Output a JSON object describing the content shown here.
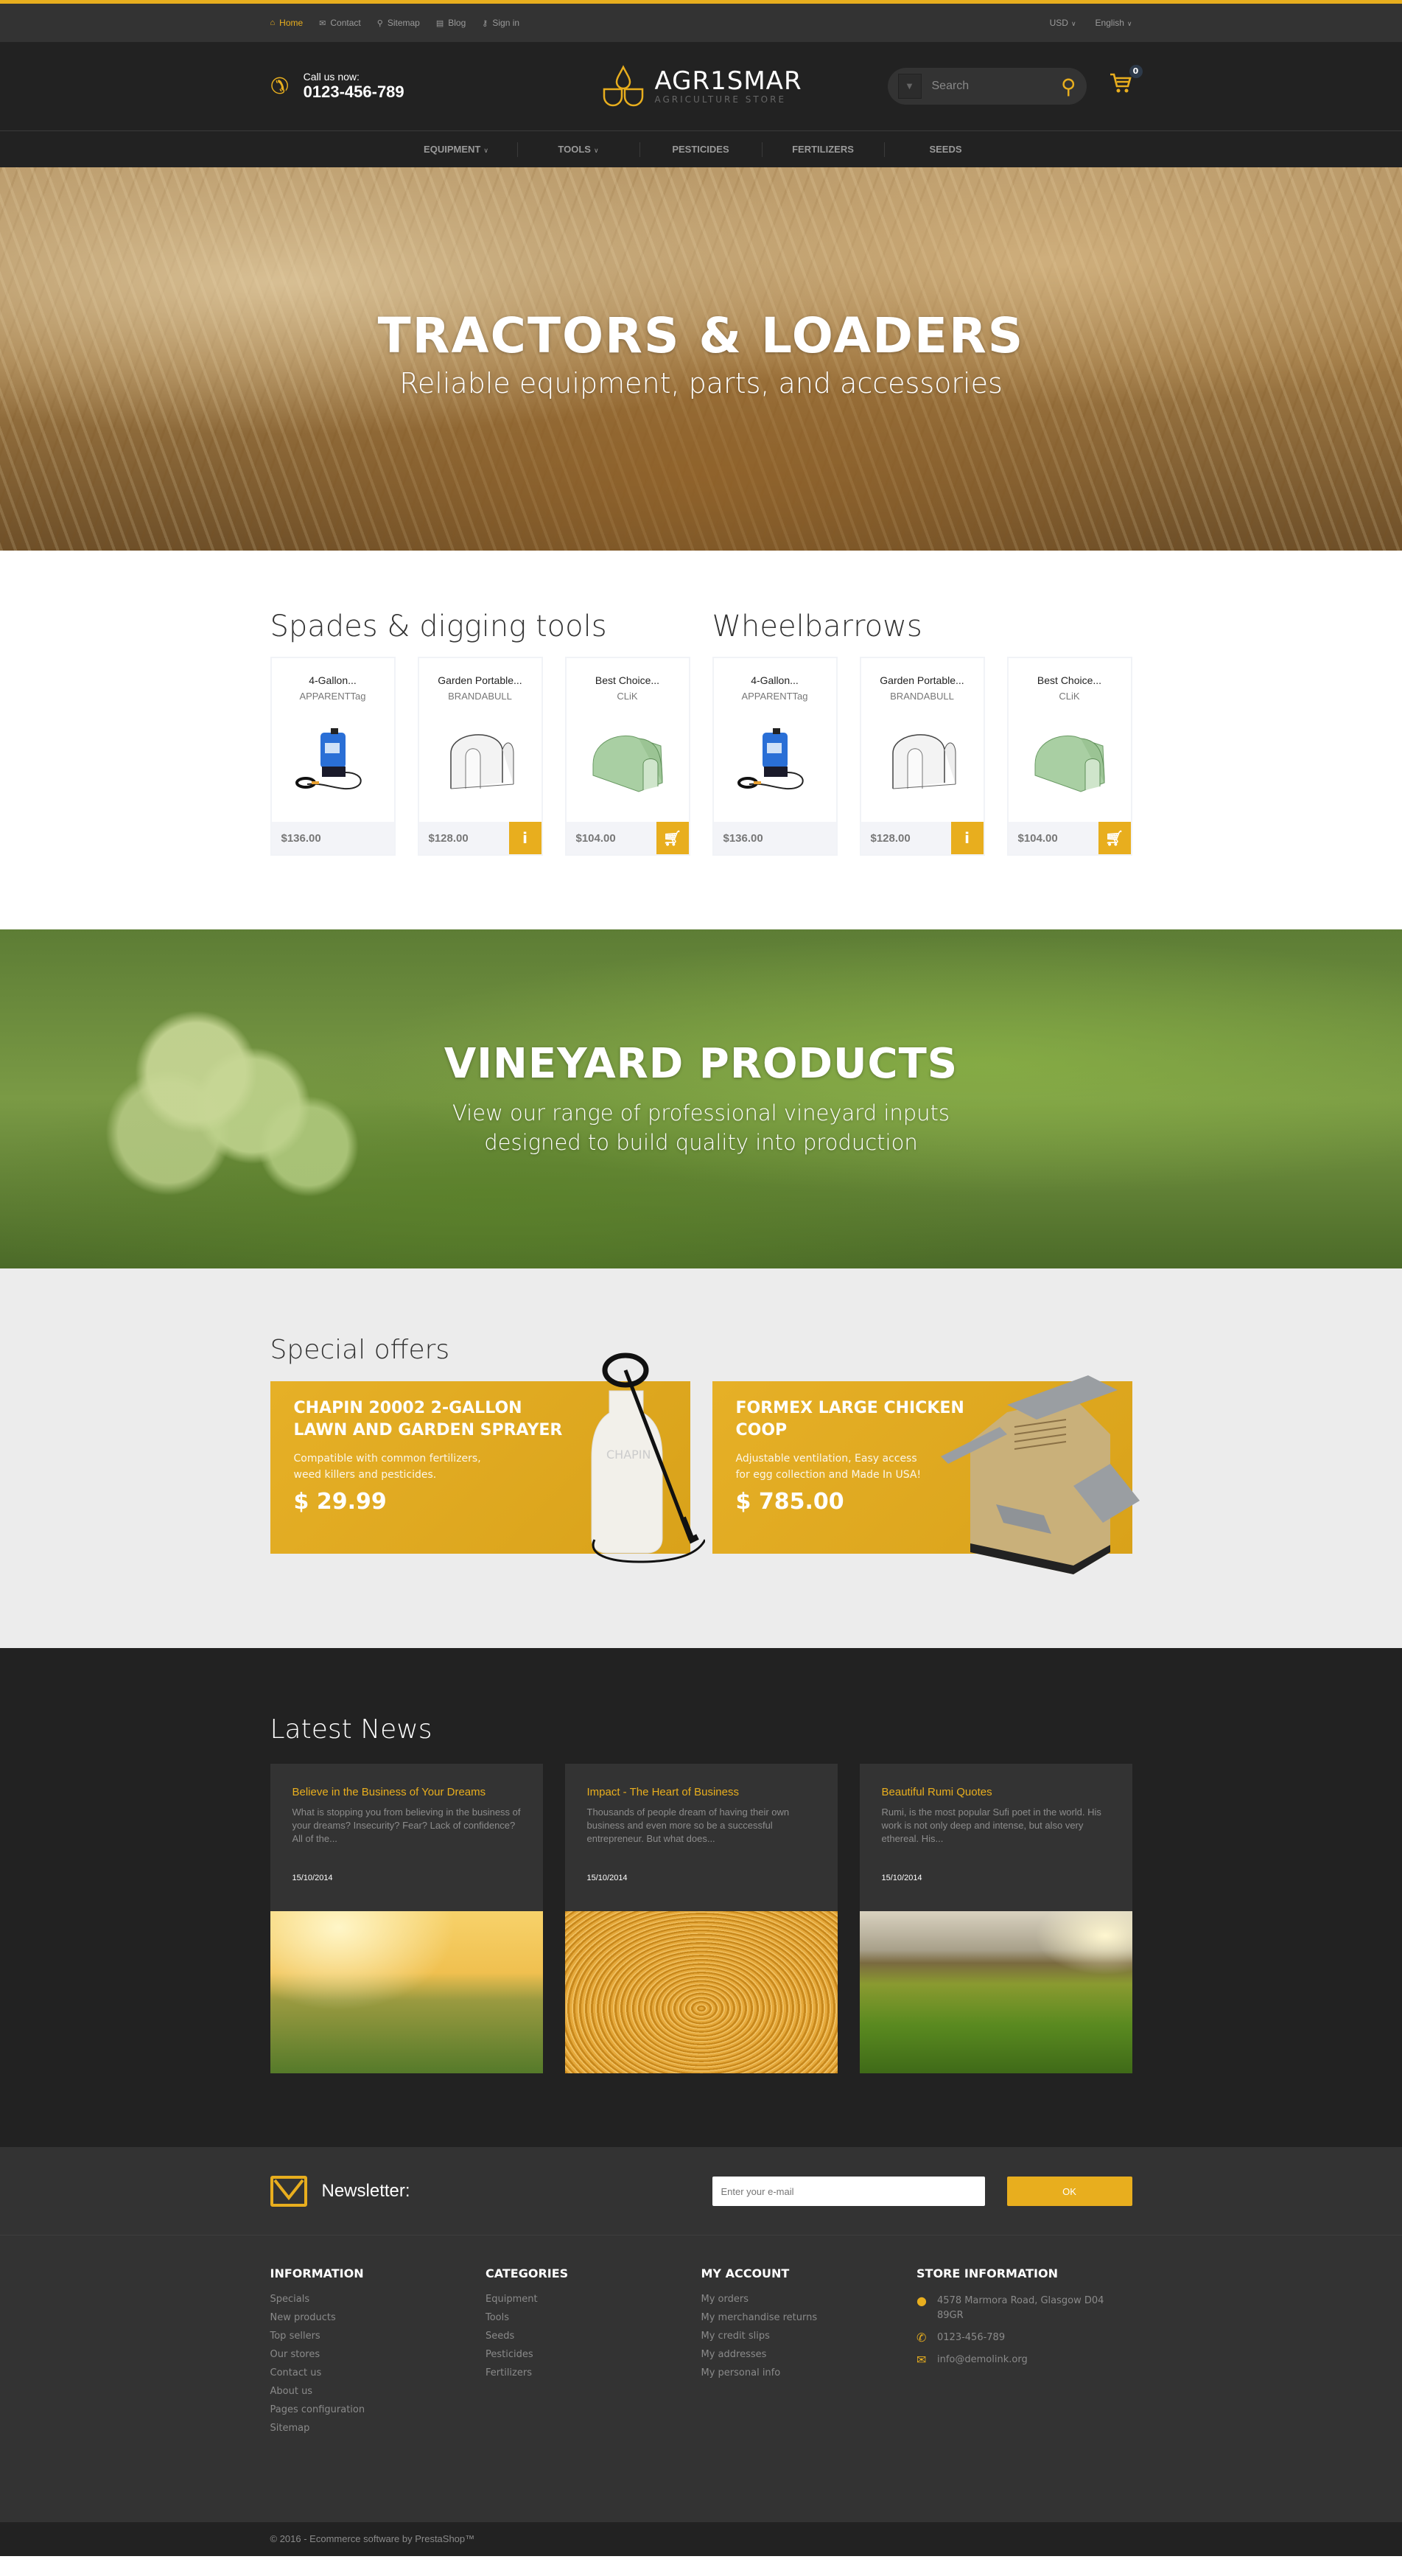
{
  "topbar": {
    "links": [
      {
        "label": "Home",
        "icon": "home-icon",
        "glyph": "⌂",
        "active": true
      },
      {
        "label": "Contact",
        "icon": "mail-icon",
        "glyph": "✉"
      },
      {
        "label": "Sitemap",
        "icon": "map-pin-icon",
        "glyph": "⚲"
      },
      {
        "label": "Blog",
        "icon": "document-icon",
        "glyph": "▤"
      },
      {
        "label": "Sign in",
        "icon": "key-icon",
        "glyph": "⚷"
      }
    ],
    "currency": "USD",
    "language": "English"
  },
  "header": {
    "call_label": "Call us now:",
    "phone": "0123-456-789",
    "logo_name": "AGR1SMAR",
    "logo_sub": "AGRICULTURE STORE",
    "search_placeholder": "Search",
    "cart_count": "0"
  },
  "nav": {
    "items": [
      {
        "label": "EQUIPMENT",
        "dropdown": true
      },
      {
        "label": "TOOLS",
        "dropdown": true
      },
      {
        "label": "PESTICIDES",
        "dropdown": false
      },
      {
        "label": "FERTILIZERS",
        "dropdown": false
      },
      {
        "label": "SEEDS",
        "dropdown": false
      }
    ]
  },
  "hero": {
    "title": "TRACTORS & LOADERS",
    "subtitle": "Reliable equipment, parts, and accessories"
  },
  "product_groups": [
    {
      "title": "Spades & digging tools",
      "products": [
        {
          "name": "4-Gallon...",
          "brand": "APPARENTTag",
          "price": "$136.00",
          "image": "sprayer",
          "action": null
        },
        {
          "name": "Garden Portable...",
          "brand": "BRANDABULL",
          "price": "$128.00",
          "image": "greenhouse-white",
          "action": "info"
        },
        {
          "name": "Best Choice...",
          "brand": "CLiK",
          "price": "$104.00",
          "image": "greenhouse-green",
          "action": "cart"
        }
      ]
    },
    {
      "title": "Wheelbarrows",
      "products": [
        {
          "name": "4-Gallon...",
          "brand": "APPARENTTag",
          "price": "$136.00",
          "image": "sprayer",
          "action": null
        },
        {
          "name": "Garden Portable...",
          "brand": "BRANDABULL",
          "price": "$128.00",
          "image": "greenhouse-white",
          "action": "info"
        },
        {
          "name": "Best Choice...",
          "brand": "CLiK",
          "price": "$104.00",
          "image": "greenhouse-green",
          "action": "cart"
        }
      ]
    }
  ],
  "vineyard": {
    "title": "VINEYARD PRODUCTS",
    "line1": "View our range of professional vineyard inputs",
    "line2": "designed to build quality into production"
  },
  "offers": {
    "title": "Special offers",
    "items": [
      {
        "title": "CHAPIN 20002 2-GALLON LAWN AND GARDEN SPRAYER",
        "desc": "Compatible with common fertilizers, weed killers and pesticides.",
        "price": "$ 29.99"
      },
      {
        "title": "FORMEX LARGE CHICKEN COOP",
        "desc": "Adjustable ventilation, Easy access for egg collection and Made In USA!",
        "price": "$ 785.00"
      }
    ]
  },
  "news": {
    "title": "Latest News",
    "items": [
      {
        "title": "Believe in the Business of Your Dreams",
        "excerpt": "What is stopping you from believing in the business of your dreams? Insecurity? Fear? Lack of confidence? All of the...",
        "date": "15/10/2014"
      },
      {
        "title": "Impact - The Heart of Business",
        "excerpt": "Thousands of people dream of having their own business and even more so be a successful entrepreneur. But what does...",
        "date": "15/10/2014"
      },
      {
        "title": "Beautiful Rumi Quotes",
        "excerpt": "Rumi, is the most popular Sufi poet in the world. His work is not only deep and intense, but also very ethereal. His...",
        "date": "15/10/2014"
      }
    ]
  },
  "newsletter": {
    "label": "Newsletter:",
    "placeholder": "Enter your e-mail",
    "button": "OK"
  },
  "footer": {
    "information": {
      "title": "INFORMATION",
      "links": [
        "Specials",
        "New products",
        "Top sellers",
        "Our stores",
        "Contact us",
        "About us",
        "Pages configuration",
        "Sitemap"
      ]
    },
    "categories": {
      "title": "CATEGORIES",
      "links": [
        "Equipment",
        "Tools",
        "Seeds",
        "Pesticides",
        "Fertilizers"
      ]
    },
    "account": {
      "title": "MY ACCOUNT",
      "links": [
        "My orders",
        "My merchandise returns",
        "My credit slips",
        "My addresses",
        "My personal info"
      ]
    },
    "store": {
      "title": "STORE INFORMATION",
      "address": "4578 Marmora Road, Glasgow D04 89GR",
      "phone": "0123-456-789",
      "email": "info@demolink.org"
    },
    "copyright": "© 2016 - Ecommerce software by PrestaShop™"
  },
  "colors": {
    "accent": "#e8ae1e",
    "dark": "#222222",
    "panel": "#333333"
  }
}
